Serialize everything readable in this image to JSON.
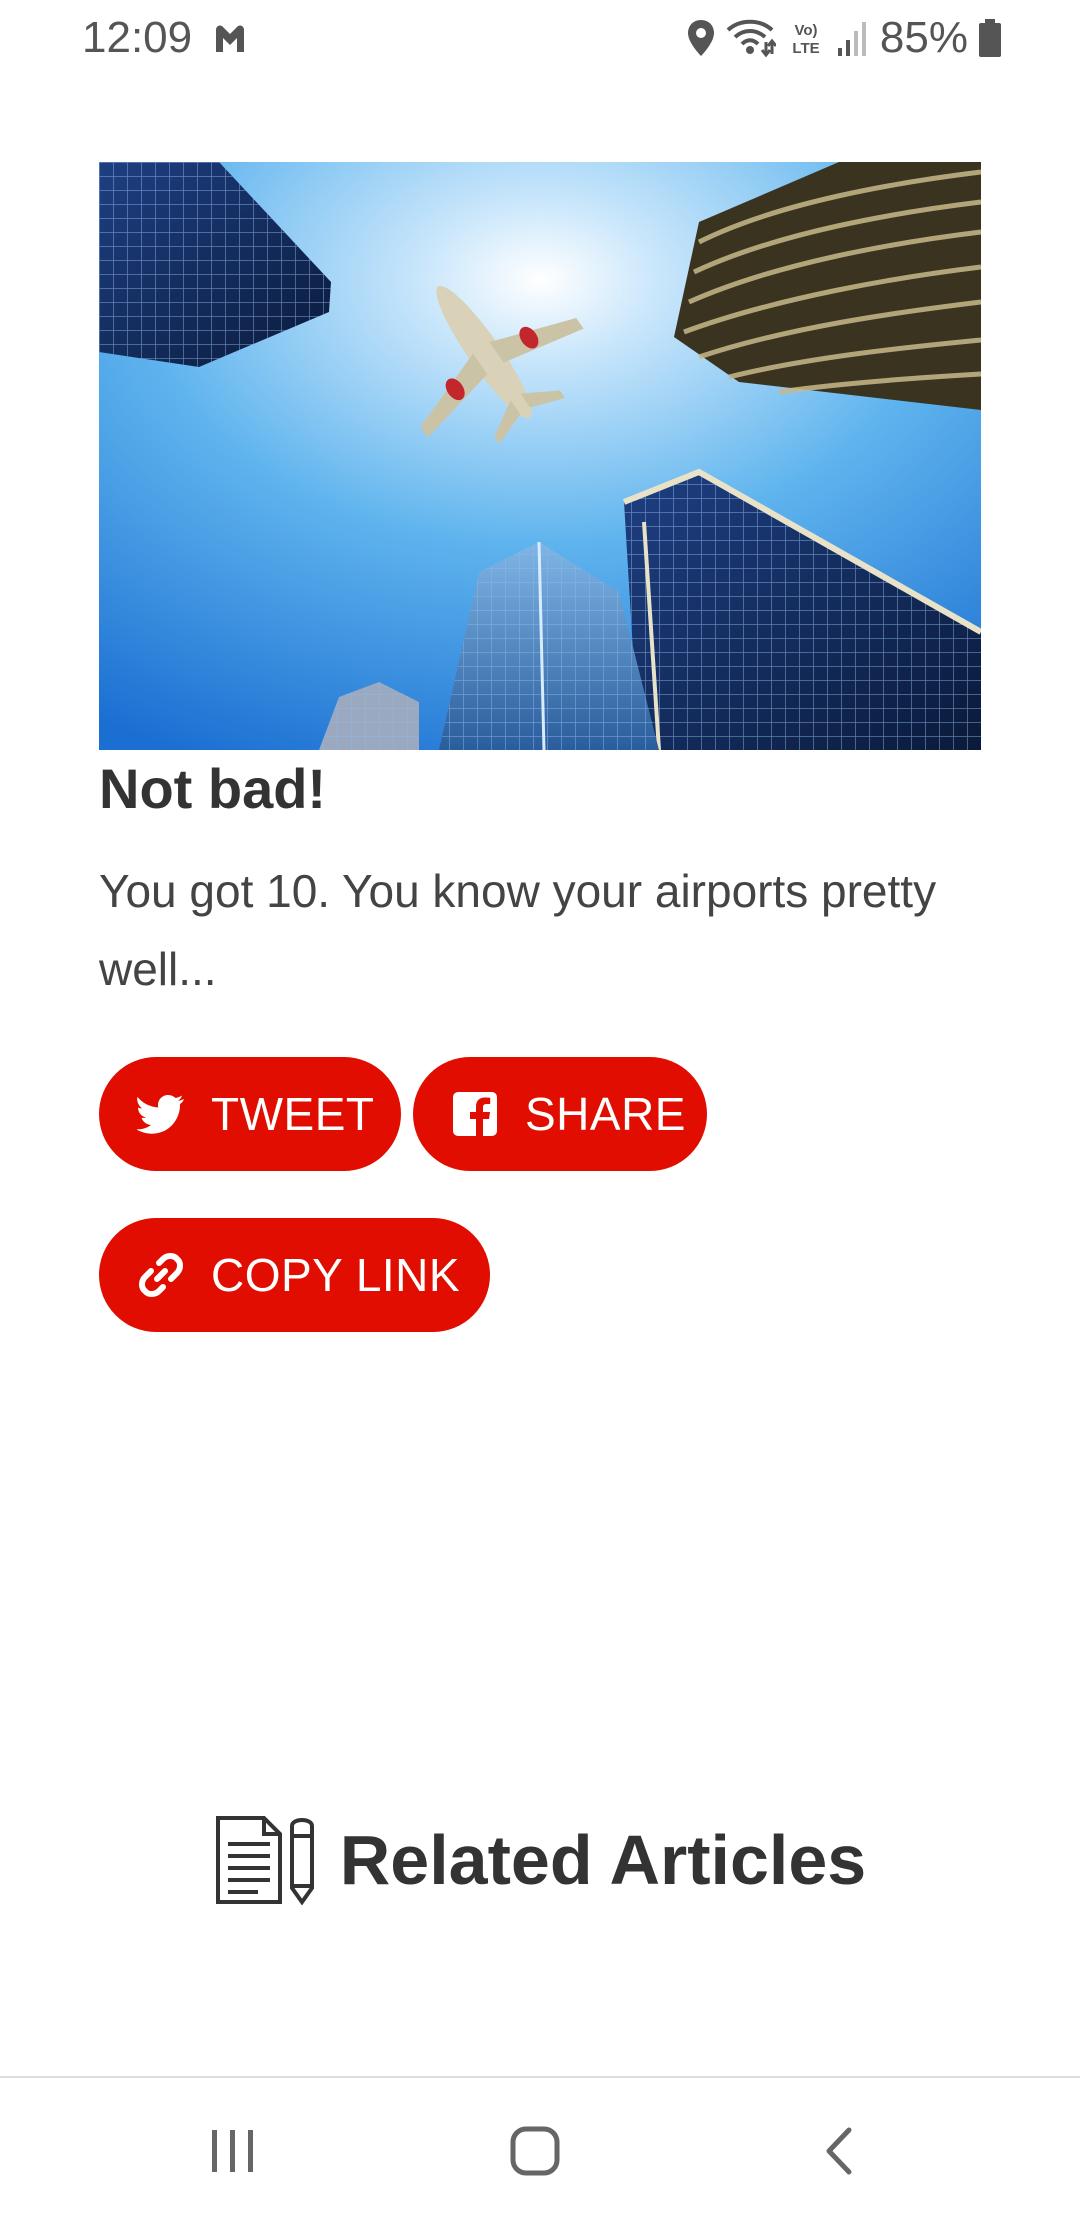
{
  "status_bar": {
    "time": "12:09",
    "battery": "85%",
    "icons": [
      "location-icon",
      "wifi-icon",
      "volte-icon",
      "signal-icon",
      "battery-icon"
    ]
  },
  "quiz_result": {
    "title": "Not bad!",
    "description": "You got 10. You know your airports pretty well..."
  },
  "share": {
    "tweet_label": "TWEET",
    "share_label": "SHARE",
    "copy_label": "COPY LINK"
  },
  "related": {
    "heading": "Related Articles"
  },
  "colors": {
    "accent": "#e00d00",
    "text": "#333333",
    "status_text": "#555555"
  }
}
